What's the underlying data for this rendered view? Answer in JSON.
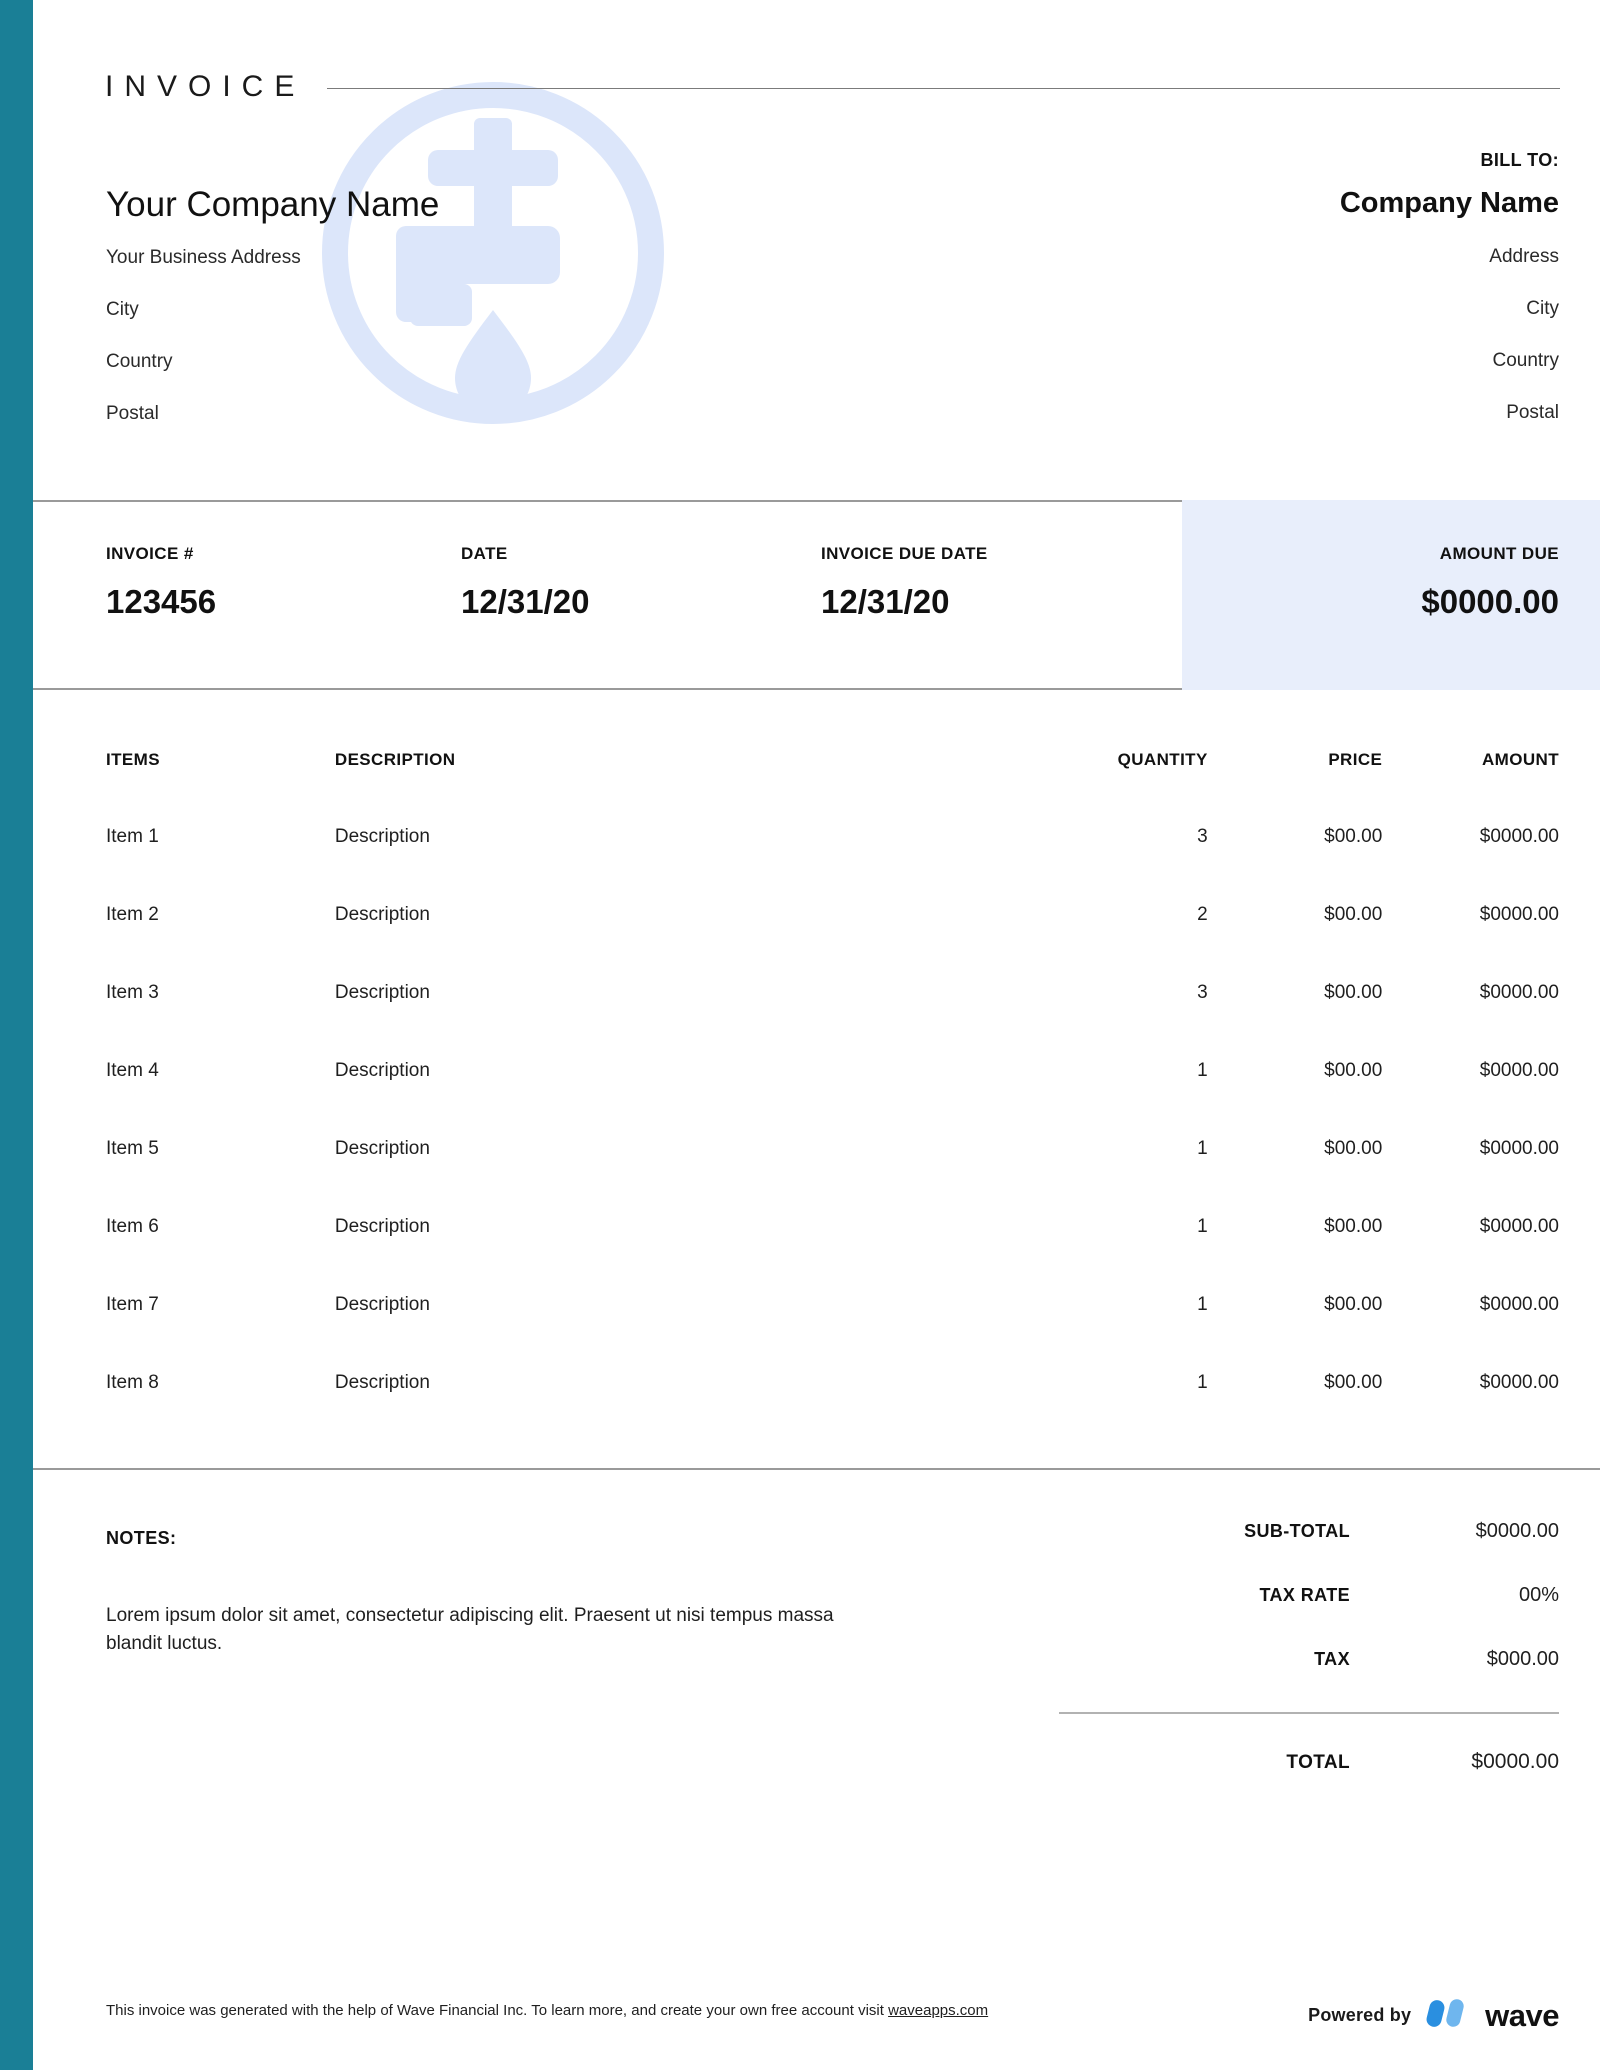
{
  "document": {
    "title": "INVOICE",
    "accent_color": "#1A7F96",
    "amount_due_panel_color": "#E8EEFB",
    "watermark_icon": "faucet-water-drop-icon"
  },
  "sender": {
    "company_name": "Your Company Name",
    "address": "Your Business Address",
    "city": "City",
    "country": "Country",
    "postal": "Postal"
  },
  "bill_to": {
    "label": "BILL TO:",
    "company_name": "Company Name",
    "address": "Address",
    "city": "City",
    "country": "Country",
    "postal": "Postal"
  },
  "meta": {
    "invoice_no_label": "INVOICE #",
    "invoice_no_value": "123456",
    "date_label": "DATE",
    "date_value": "12/31/20",
    "due_date_label": "INVOICE DUE DATE",
    "due_date_value": "12/31/20",
    "amount_due_label": "AMOUNT DUE",
    "amount_due_value": "$0000.00"
  },
  "items_table": {
    "headers": {
      "items": "ITEMS",
      "description": "DESCRIPTION",
      "quantity": "QUANTITY",
      "price": "PRICE",
      "amount": "AMOUNT"
    },
    "rows": [
      {
        "item": "Item 1",
        "description": "Description",
        "quantity": "3",
        "price": "$00.00",
        "amount": "$0000.00"
      },
      {
        "item": "Item 2",
        "description": "Description",
        "quantity": "2",
        "price": "$00.00",
        "amount": "$0000.00"
      },
      {
        "item": "Item 3",
        "description": "Description",
        "quantity": "3",
        "price": "$00.00",
        "amount": "$0000.00"
      },
      {
        "item": "Item 4",
        "description": "Description",
        "quantity": "1",
        "price": "$00.00",
        "amount": "$0000.00"
      },
      {
        "item": "Item 5",
        "description": "Description",
        "quantity": "1",
        "price": "$00.00",
        "amount": "$0000.00"
      },
      {
        "item": "Item 6",
        "description": "Description",
        "quantity": "1",
        "price": "$00.00",
        "amount": "$0000.00"
      },
      {
        "item": "Item 7",
        "description": "Description",
        "quantity": "1",
        "price": "$00.00",
        "amount": "$0000.00"
      },
      {
        "item": "Item 8",
        "description": "Description",
        "quantity": "1",
        "price": "$00.00",
        "amount": "$0000.00"
      }
    ]
  },
  "notes": {
    "label": "NOTES:",
    "body": "Lorem ipsum dolor sit amet, consectetur adipiscing elit. Praesent ut nisi tempus massa blandit luctus."
  },
  "totals": {
    "subtotal_label": "SUB-TOTAL",
    "subtotal_value": "$0000.00",
    "tax_rate_label": "TAX RATE",
    "tax_rate_value": "00%",
    "tax_label": "TAX",
    "tax_value": "$000.00",
    "total_label": "TOTAL",
    "total_value": "$0000.00"
  },
  "footer": {
    "text_before_link": "This invoice was generated with the help of Wave Financial Inc. To learn more, and create your own free account visit ",
    "link_text": "waveapps.com",
    "powered_by_label": "Powered by",
    "brand_name": "wave",
    "brand_color": "#2A8FE0"
  }
}
